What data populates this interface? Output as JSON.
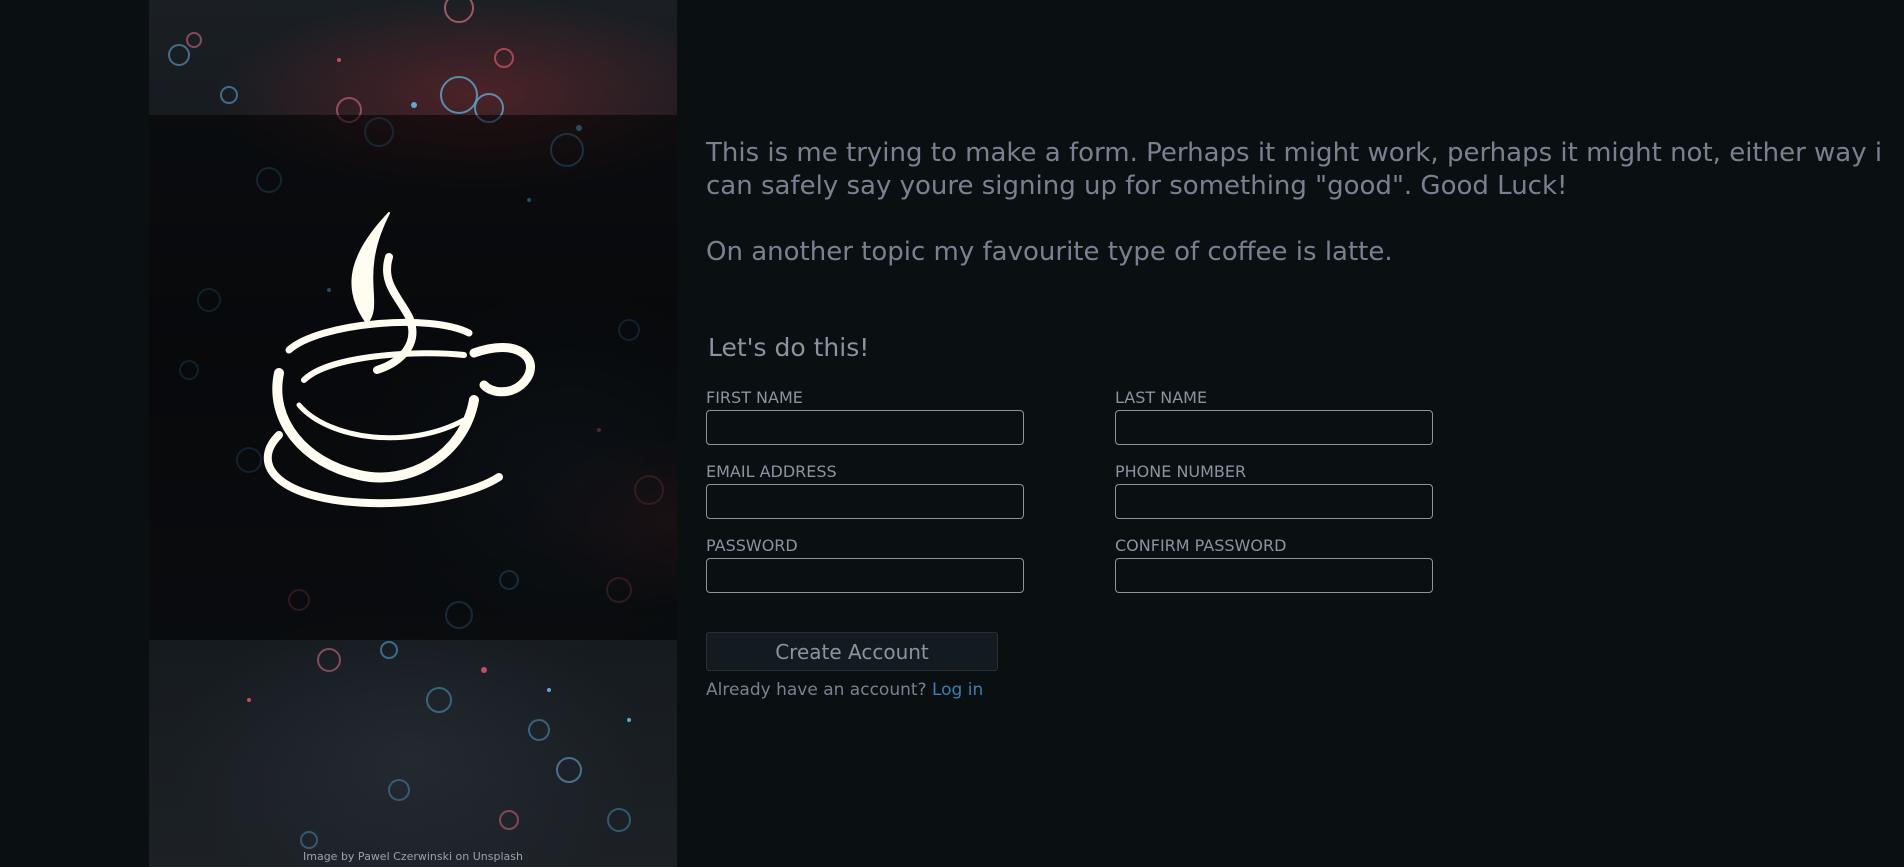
{
  "intro": {
    "paragraph1": "This is me trying to make a form. Perhaps it might work, perhaps it might not, either way i can safely say youre signing up for something \"good\". Good Luck!",
    "paragraph2": "On another topic my favourite type of coffee is latte."
  },
  "image": {
    "credit": "Image by Pawel Czerwinski on Unsplash",
    "logo_icon": "coffee-cup-icon"
  },
  "form": {
    "title": "Let's do this!",
    "fields": {
      "first_name": {
        "label": "FIRST NAME",
        "value": ""
      },
      "last_name": {
        "label": "LAST NAME",
        "value": ""
      },
      "email": {
        "label": "EMAIL ADDRESS",
        "value": ""
      },
      "phone": {
        "label": "PHONE NUMBER",
        "value": ""
      },
      "password": {
        "label": "PASSWORD",
        "value": ""
      },
      "confirm_password": {
        "label": "CONFIRM PASSWORD",
        "value": ""
      }
    },
    "submit_label": "Create Account",
    "login_prompt": "Already have an account?",
    "login_link": "Log in"
  },
  "colors": {
    "background": "#0a1012",
    "text": "#7a8090",
    "link": "#3a7fb8",
    "input_border": "#8f949c"
  }
}
